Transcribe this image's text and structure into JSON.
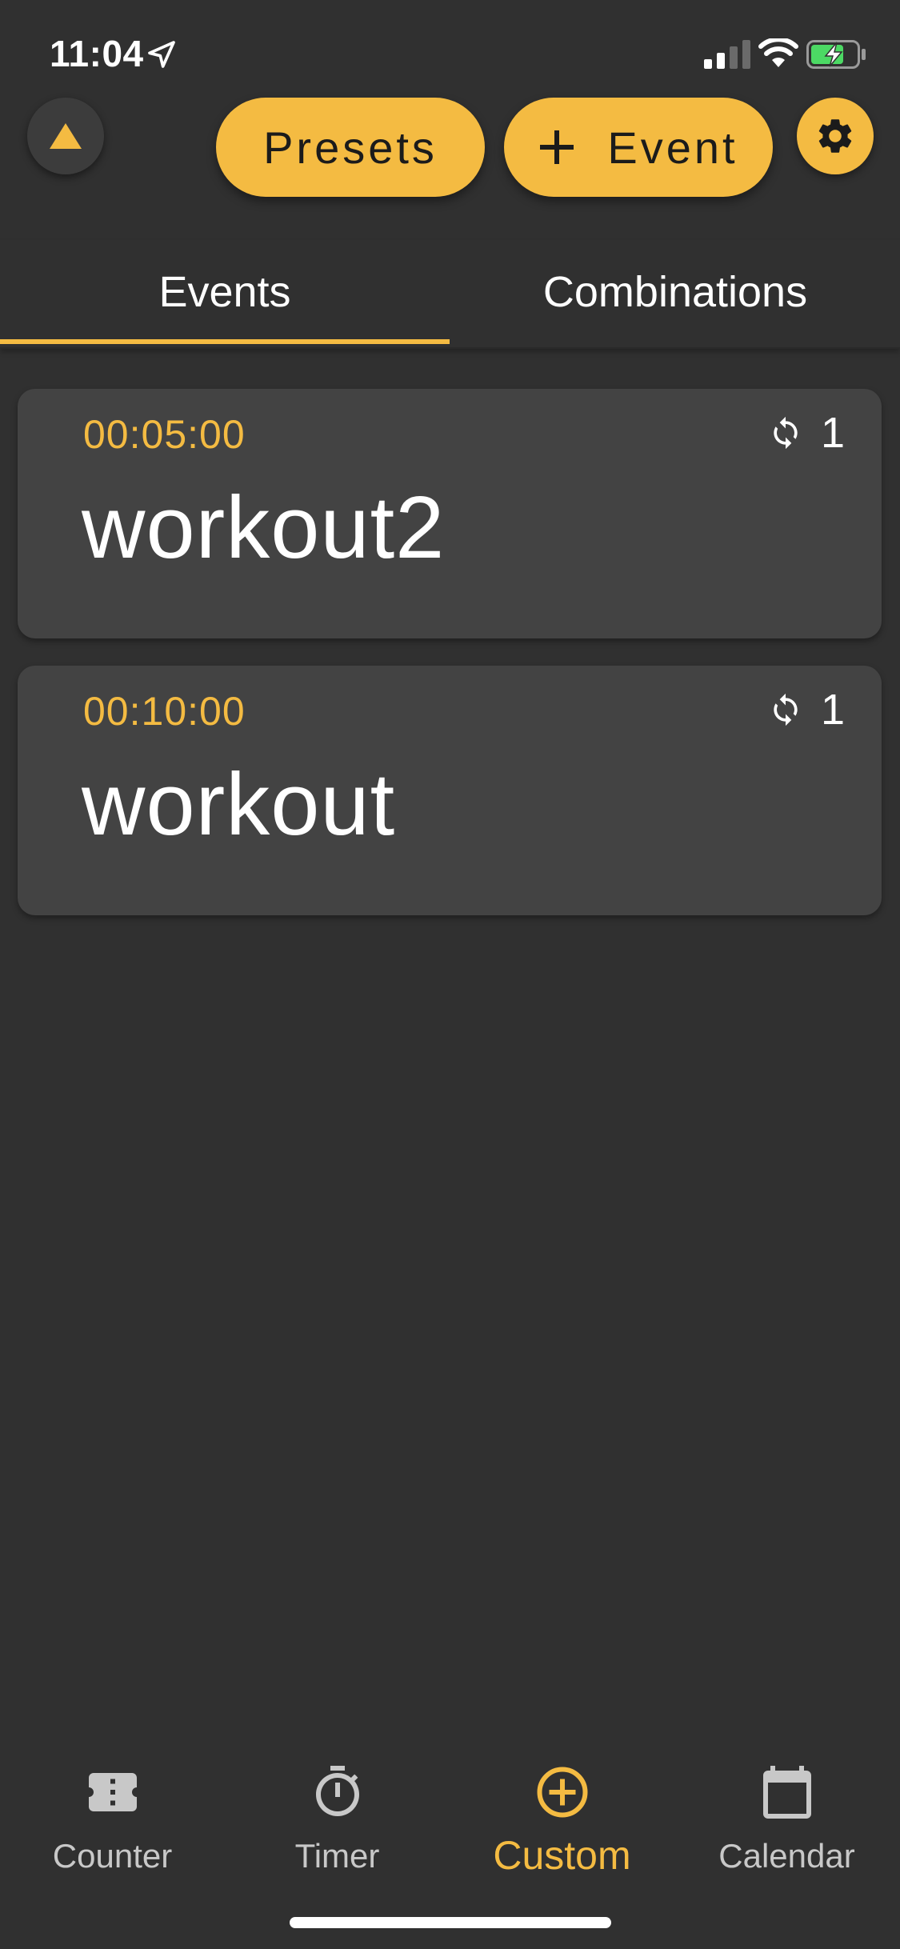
{
  "status_bar": {
    "time": "11:04",
    "location_icon": "location-arrow-icon",
    "signal_icon": "cellular-signal-icon",
    "wifi_icon": "wifi-icon",
    "battery_icon": "battery-charging-icon"
  },
  "header": {
    "collapse_icon": "triangle-up-icon",
    "presets_label": "Presets",
    "event_label": "Event",
    "event_icon": "plus-icon",
    "settings_icon": "gear-icon"
  },
  "tabs": [
    {
      "label": "Events",
      "selected": true
    },
    {
      "label": "Combinations",
      "selected": false
    }
  ],
  "events": [
    {
      "duration": "00:05:00",
      "name": "workout2",
      "repeat_count": "1",
      "repeat_icon": "repeat-icon"
    },
    {
      "duration": "00:10:00",
      "name": "workout",
      "repeat_count": "1",
      "repeat_icon": "repeat-icon"
    }
  ],
  "bottom_nav": [
    {
      "label": "Counter",
      "icon": "ticket-icon",
      "active": false
    },
    {
      "label": "Timer",
      "icon": "stopwatch-icon",
      "active": false
    },
    {
      "label": "Custom",
      "icon": "plus-circle-icon",
      "active": true
    },
    {
      "label": "Calendar",
      "icon": "calendar-icon",
      "active": false
    }
  ],
  "colors": {
    "accent": "#f4bb42",
    "background": "#303030",
    "card": "#434343",
    "text": "#ffffff",
    "inactive_nav": "#c8c8c8"
  }
}
